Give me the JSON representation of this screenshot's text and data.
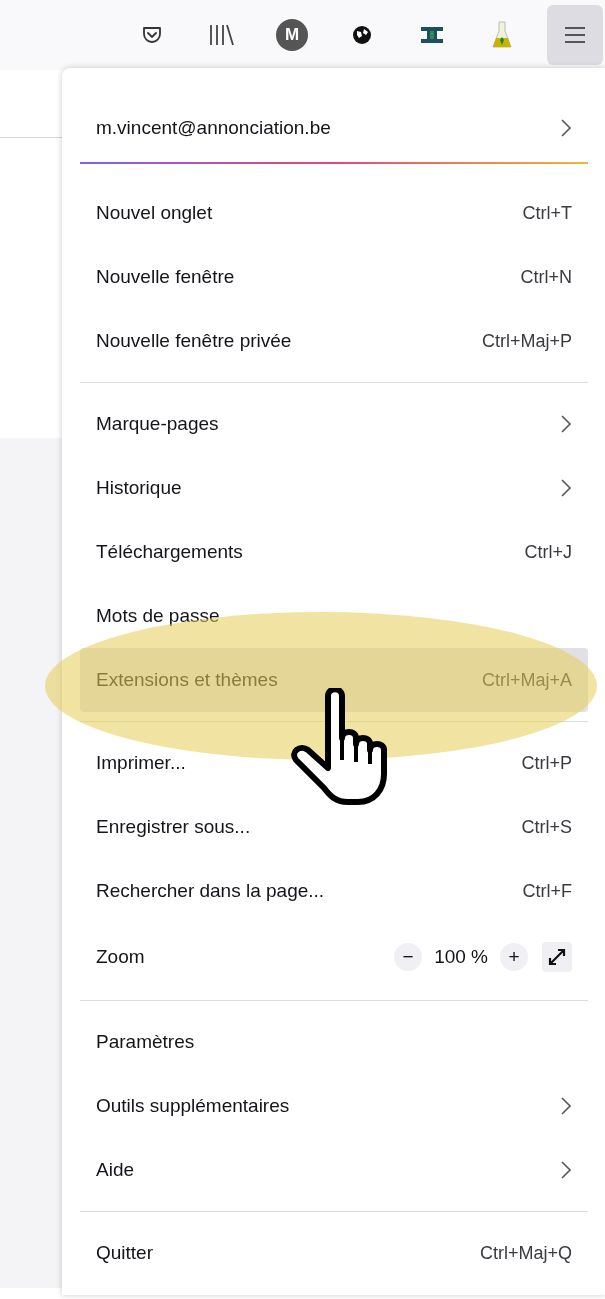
{
  "toolbar": {
    "buttons": [
      {
        "kind": "pocket",
        "selected": false
      },
      {
        "kind": "library",
        "selected": false
      },
      {
        "kind": "avatar",
        "label": "M",
        "selected": false
      },
      {
        "kind": "globe",
        "selected": false
      },
      {
        "kind": "extension",
        "selected": false
      },
      {
        "kind": "flask",
        "selected": false
      },
      {
        "kind": "menu",
        "selected": true
      }
    ]
  },
  "menu": {
    "account": "m.vincent@annonciation.be",
    "items": [
      {
        "kind": "item",
        "label": "Nouvel onglet",
        "shortcut": "Ctrl+T",
        "submenu": false,
        "selected": false
      },
      {
        "kind": "item",
        "label": "Nouvelle fenêtre",
        "shortcut": "Ctrl+N",
        "submenu": false,
        "selected": false
      },
      {
        "kind": "item",
        "label": "Nouvelle fenêtre privée",
        "shortcut": "Ctrl+Maj+P",
        "submenu": false,
        "selected": false
      },
      {
        "kind": "separator"
      },
      {
        "kind": "item",
        "label": "Marque-pages",
        "submenu": true,
        "selected": false
      },
      {
        "kind": "item",
        "label": "Historique",
        "submenu": true,
        "selected": false
      },
      {
        "kind": "item",
        "label": "Téléchargements",
        "shortcut": "Ctrl+J",
        "submenu": false,
        "selected": false
      },
      {
        "kind": "item",
        "label": "Mots de passe",
        "submenu": false,
        "selected": false
      },
      {
        "kind": "item",
        "label": "Extensions et thèmes",
        "shortcut": "Ctrl+Maj+A",
        "submenu": false,
        "selected": true
      },
      {
        "kind": "separator"
      },
      {
        "kind": "item",
        "label": "Imprimer...",
        "shortcut": "Ctrl+P",
        "submenu": false,
        "selected": false
      },
      {
        "kind": "item",
        "label": "Enregistrer sous...",
        "shortcut": "Ctrl+S",
        "submenu": false,
        "selected": false
      },
      {
        "kind": "item",
        "label": "Rechercher dans la page...",
        "shortcut": "Ctrl+F",
        "submenu": false,
        "selected": false
      },
      {
        "kind": "zoom",
        "label": "Zoom",
        "minus": "−",
        "value": "100 %",
        "plus": "+"
      },
      {
        "kind": "separator"
      },
      {
        "kind": "item",
        "label": "Paramètres",
        "submenu": false,
        "selected": false
      },
      {
        "kind": "item",
        "label": "Outils supplémentaires",
        "submenu": true,
        "selected": false
      },
      {
        "kind": "item",
        "label": "Aide",
        "submenu": true,
        "selected": false
      },
      {
        "kind": "separator"
      },
      {
        "kind": "item",
        "label": "Quitter",
        "shortcut": "Ctrl+Maj+Q",
        "submenu": false,
        "selected": false
      }
    ]
  }
}
